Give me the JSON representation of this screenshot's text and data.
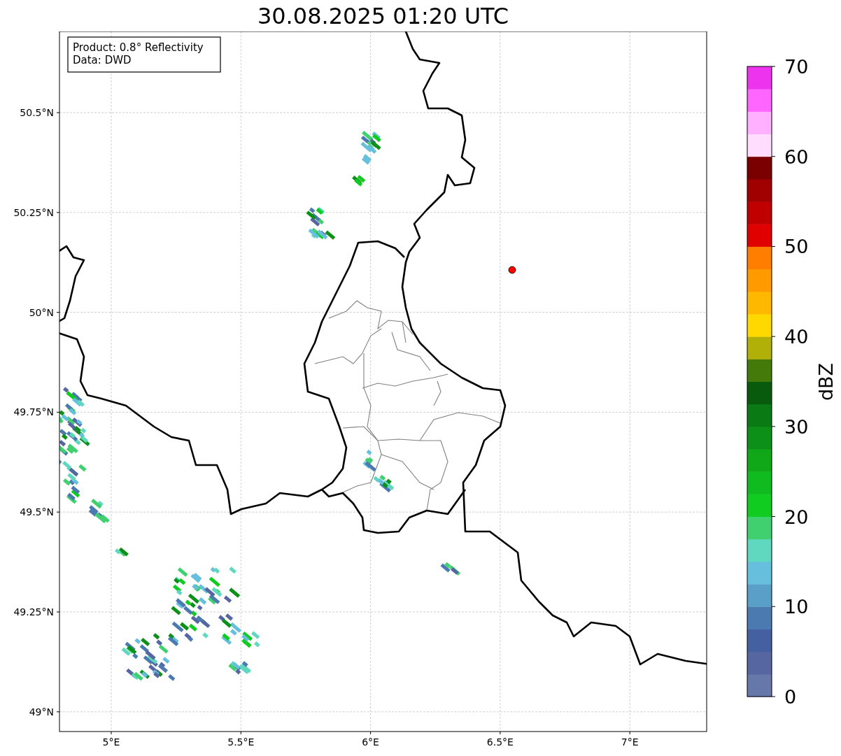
{
  "title": "30.08.2025 01:20 UTC",
  "info_box": [
    "Product: 0.8° Reflectivity",
    "Data: DWD"
  ],
  "map": {
    "x_ticks": [
      "5°E",
      "5.5°E",
      "6°E",
      "6.5°E",
      "7°E"
    ],
    "y_ticks": [
      "50.5°N",
      "50.25°N",
      "50°N",
      "49.75°N",
      "49.5°N",
      "49.25°N",
      "49°N"
    ],
    "marker": {
      "color": "#ff0000"
    }
  },
  "colorbar": {
    "label": "dBZ",
    "ticks": [
      "70",
      "60",
      "50",
      "40",
      "30",
      "20",
      "10",
      "0"
    ],
    "segments": [
      {
        "color": "#6677aa"
      },
      {
        "color": "#5566a0"
      },
      {
        "color": "#4560a0"
      },
      {
        "color": "#4a7ab0"
      },
      {
        "color": "#5a9fc8"
      },
      {
        "color": "#66c0dd"
      },
      {
        "color": "#60d8c0"
      },
      {
        "color": "#40d070"
      },
      {
        "color": "#10cc20"
      },
      {
        "color": "#10bb20"
      },
      {
        "color": "#10a818"
      },
      {
        "color": "#0c9018"
      },
      {
        "color": "#0a7a14"
      },
      {
        "color": "#085a0c"
      },
      {
        "color": "#447a0a"
      },
      {
        "color": "#b0b008"
      },
      {
        "color": "#ffd800"
      },
      {
        "color": "#ffb800"
      },
      {
        "color": "#ff9a00"
      },
      {
        "color": "#ff7e00"
      },
      {
        "color": "#e00000"
      },
      {
        "color": "#c00000"
      },
      {
        "color": "#a00000"
      },
      {
        "color": "#7a0000"
      },
      {
        "color": "#ffddff"
      },
      {
        "color": "#ffb0ff"
      },
      {
        "color": "#ff66ff"
      },
      {
        "color": "#ee33ee"
      }
    ]
  }
}
